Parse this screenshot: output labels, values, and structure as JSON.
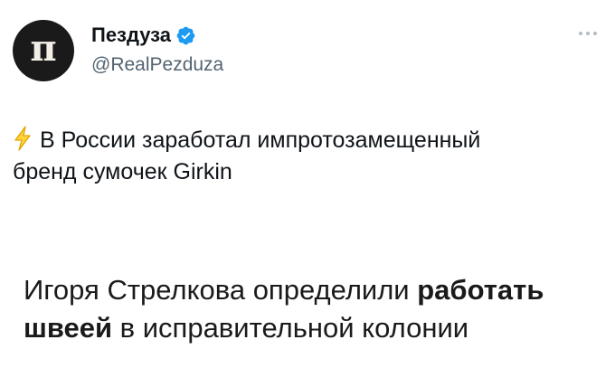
{
  "author": {
    "display_name": "Пездуза",
    "handle": "@RealPezduza",
    "avatar_glyph": "п",
    "avatar_color": "#1a1a1a",
    "verified": true,
    "verified_color": "#1d9bf0"
  },
  "tweet": {
    "line1": "В России заработал импротозамещенный",
    "line2": "бренд сумочек Girkin",
    "icon": "lightning-icon"
  },
  "headline": {
    "part1": "Игоря Стрелкова определили ",
    "bold1": "работать",
    "bold2": "швеей",
    "part2": " в исправительной колонии"
  },
  "more_icon": "more-horizontal-icon"
}
